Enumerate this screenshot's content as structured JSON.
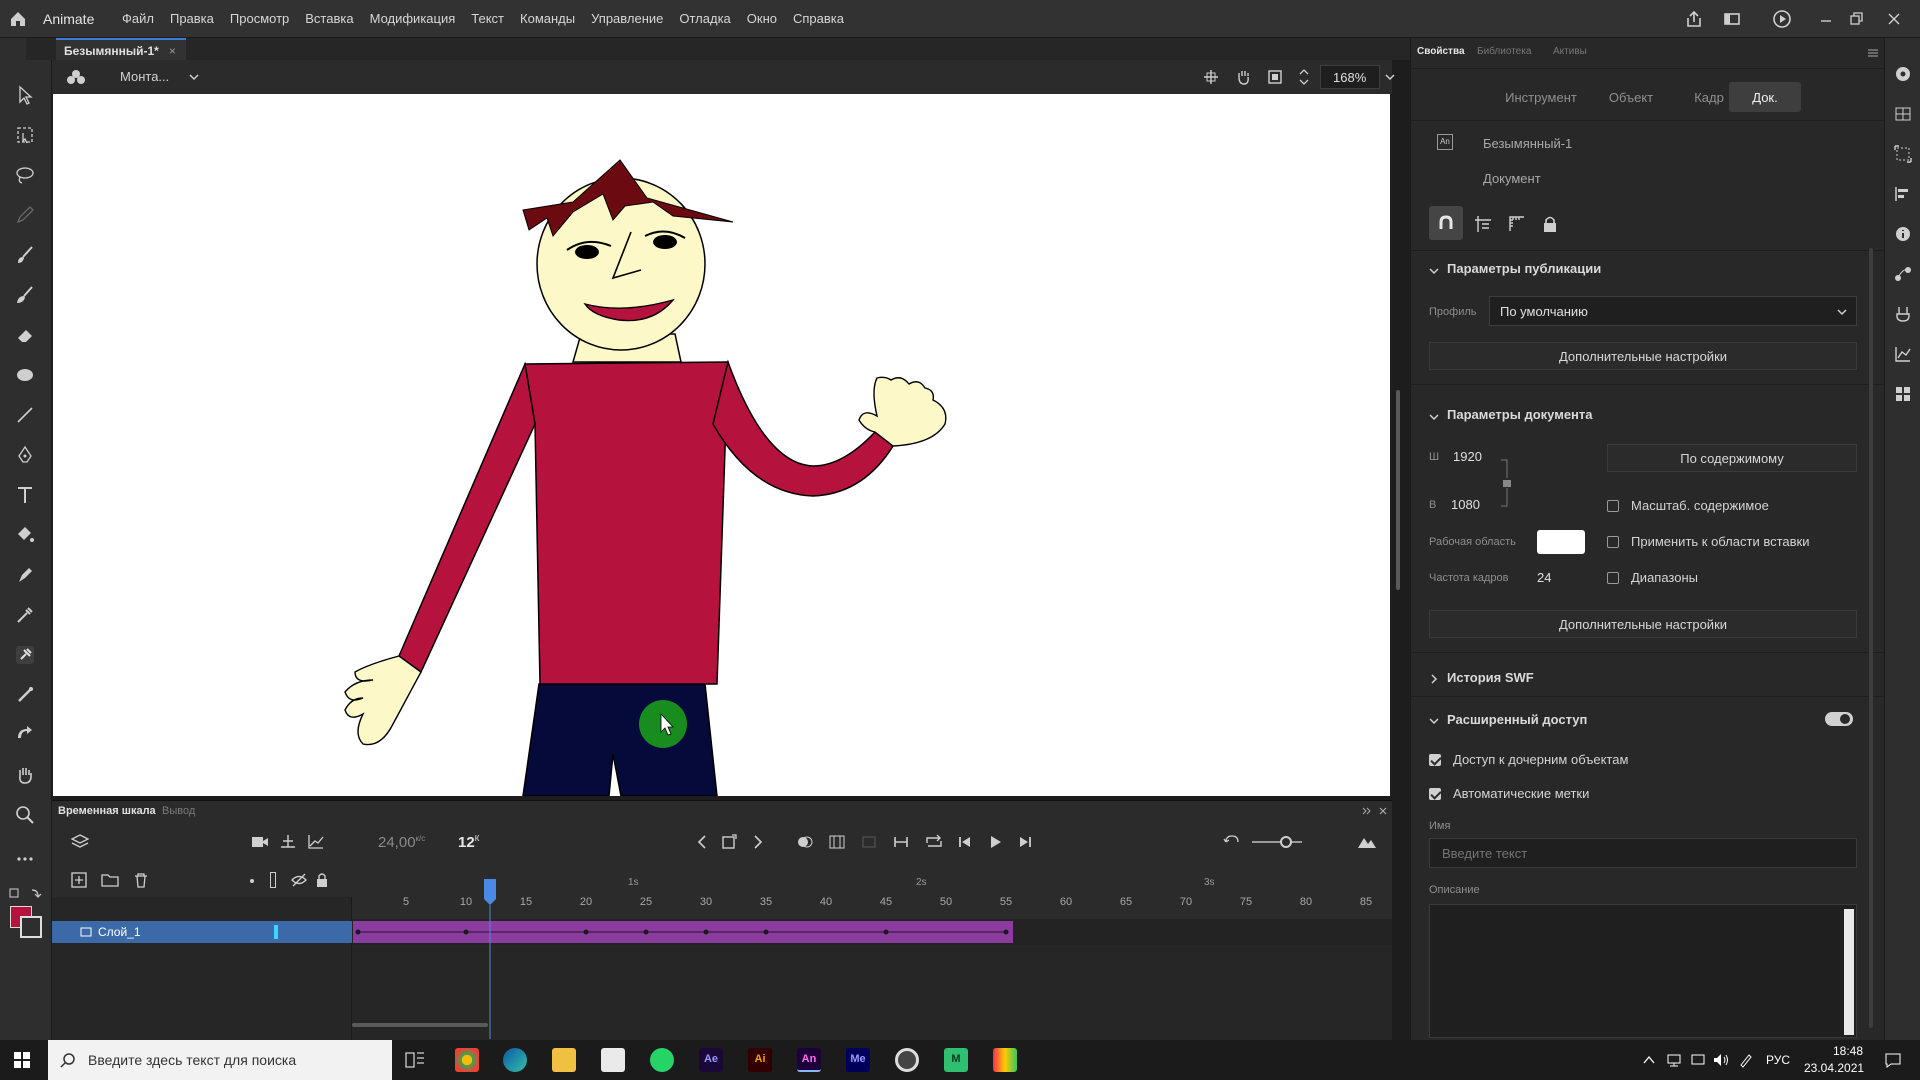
{
  "app": {
    "name": "Animate"
  },
  "menu": [
    "Файл",
    "Правка",
    "Просмотр",
    "Вставка",
    "Модификация",
    "Текст",
    "Команды",
    "Управление",
    "Отладка",
    "Окно",
    "Справка"
  ],
  "document_tab": {
    "title": "Безымянный-1*",
    "close": "×"
  },
  "editbar": {
    "scene": "Монта...",
    "zoom": "168%"
  },
  "timeline": {
    "tabs": [
      "Временная шкала",
      "Вывод"
    ],
    "fps": "24,00",
    "fps_unit": "к/с",
    "current_frame": "12",
    "current_frame_unit": "К",
    "layer_name": "Слой_1",
    "frame_ticks": [
      "5",
      "10",
      "15",
      "20",
      "25",
      "30",
      "35",
      "40",
      "45",
      "50",
      "55",
      "60",
      "65",
      "70",
      "75",
      "80",
      "85"
    ],
    "seconds": [
      "1s",
      "2s",
      "3s"
    ],
    "keyframes": [
      1,
      10,
      20,
      25,
      30,
      35,
      45,
      55
    ],
    "tween_end_frame": 55
  },
  "right_panel": {
    "tabs": [
      "Свойства",
      "Библиотека",
      "Активы"
    ],
    "segments": [
      "Инструмент",
      "Объект",
      "Кадр",
      "Док."
    ],
    "doc_name": "Безымянный-1",
    "doc_type": "Документ",
    "publish": {
      "header": "Параметры публикации",
      "profile_label": "Профиль",
      "profile_value": "По умолчанию",
      "more_button": "Дополнительные настройки"
    },
    "document": {
      "header": "Параметры документа",
      "width_label": "Ш",
      "width": "1920",
      "height_label": "В",
      "height": "1080",
      "fit_button": "По содержимому",
      "scale_content": "Масштаб. содержимое",
      "workspace_label": "Рабочая область",
      "apply_paste": "Применить к области вставки",
      "fps_label": "Частота кадров",
      "fps": "24",
      "ranges": "Диапазоны",
      "more_button": "Дополнительные настройки"
    },
    "swf_history": "История SWF",
    "accessibility": {
      "header": "Расширенный доступ",
      "child_access": "Доступ к дочерним объектам",
      "auto_labels": "Автоматические метки",
      "name_label": "Имя",
      "name_placeholder": "Введите текст",
      "desc_label": "Описание"
    }
  },
  "taskbar": {
    "search_placeholder": "Введите здесь текст для поиска",
    "apps": [
      "Ae",
      "Ai",
      "An",
      "Me",
      "M"
    ],
    "lang": "РУС",
    "time": "18:48",
    "date": "23.04.2021"
  },
  "colors": {
    "shirt": "#b5123e",
    "pants": "#050a3a",
    "skin": "#fdf8c8",
    "hair": "#6b0a10",
    "tween": "#8a3d9f",
    "layer_selected": "#3c6aa8",
    "cursor_highlight": "#1aa51a"
  }
}
